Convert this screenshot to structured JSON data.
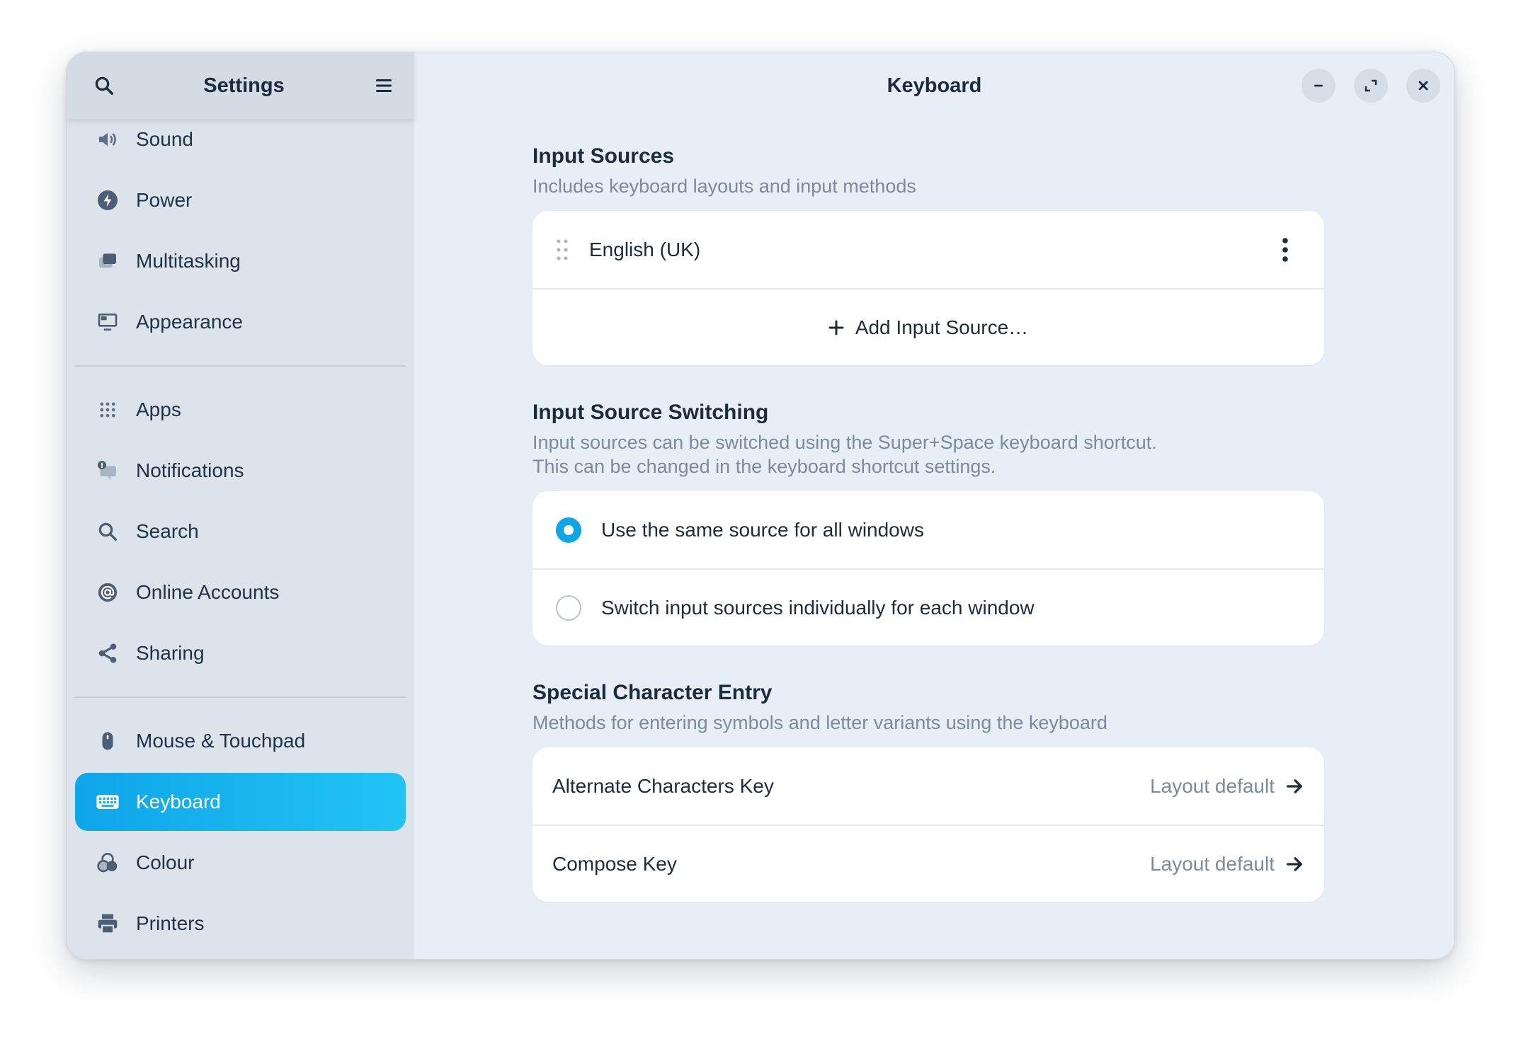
{
  "sidebar": {
    "title": "Settings",
    "items": [
      {
        "label": "Sound",
        "icon": "speaker-icon"
      },
      {
        "label": "Power",
        "icon": "power-bolt-icon"
      },
      {
        "label": "Multitasking",
        "icon": "multitasking-icon"
      },
      {
        "label": "Appearance",
        "icon": "monitor-icon"
      },
      {
        "label": "Apps",
        "icon": "apps-grid-icon"
      },
      {
        "label": "Notifications",
        "icon": "notification-icon"
      },
      {
        "label": "Search",
        "icon": "search-icon"
      },
      {
        "label": "Online Accounts",
        "icon": "at-sign-icon"
      },
      {
        "label": "Sharing",
        "icon": "share-icon"
      },
      {
        "label": "Mouse & Touchpad",
        "icon": "mouse-icon"
      },
      {
        "label": "Keyboard",
        "icon": "keyboard-icon",
        "active": true
      },
      {
        "label": "Colour",
        "icon": "colour-icon"
      },
      {
        "label": "Printers",
        "icon": "printer-icon"
      }
    ]
  },
  "main": {
    "title": "Keyboard",
    "input_sources": {
      "title": "Input Sources",
      "subtitle": "Includes keyboard layouts and input methods",
      "source": "English (UK)",
      "add_label": "Add Input Source…"
    },
    "switching": {
      "title": "Input Source Switching",
      "subtitle_line1": "Input sources can be switched using the Super+Space keyboard shortcut.",
      "subtitle_line2": "This can be changed in the keyboard shortcut settings.",
      "option_same": "Use the same source for all windows",
      "option_individual": "Switch input sources individually for each window",
      "selected": "same"
    },
    "special": {
      "title": "Special Character Entry",
      "subtitle": "Methods for entering symbols and letter variants using the keyboard",
      "alternate_label": "Alternate Characters Key",
      "alternate_value": "Layout default",
      "compose_label": "Compose Key",
      "compose_value": "Layout default"
    }
  },
  "colors": {
    "accent": "#0ea5e9",
    "sidebar_bg": "#dce3eb",
    "main_bg": "#e8eef5"
  }
}
